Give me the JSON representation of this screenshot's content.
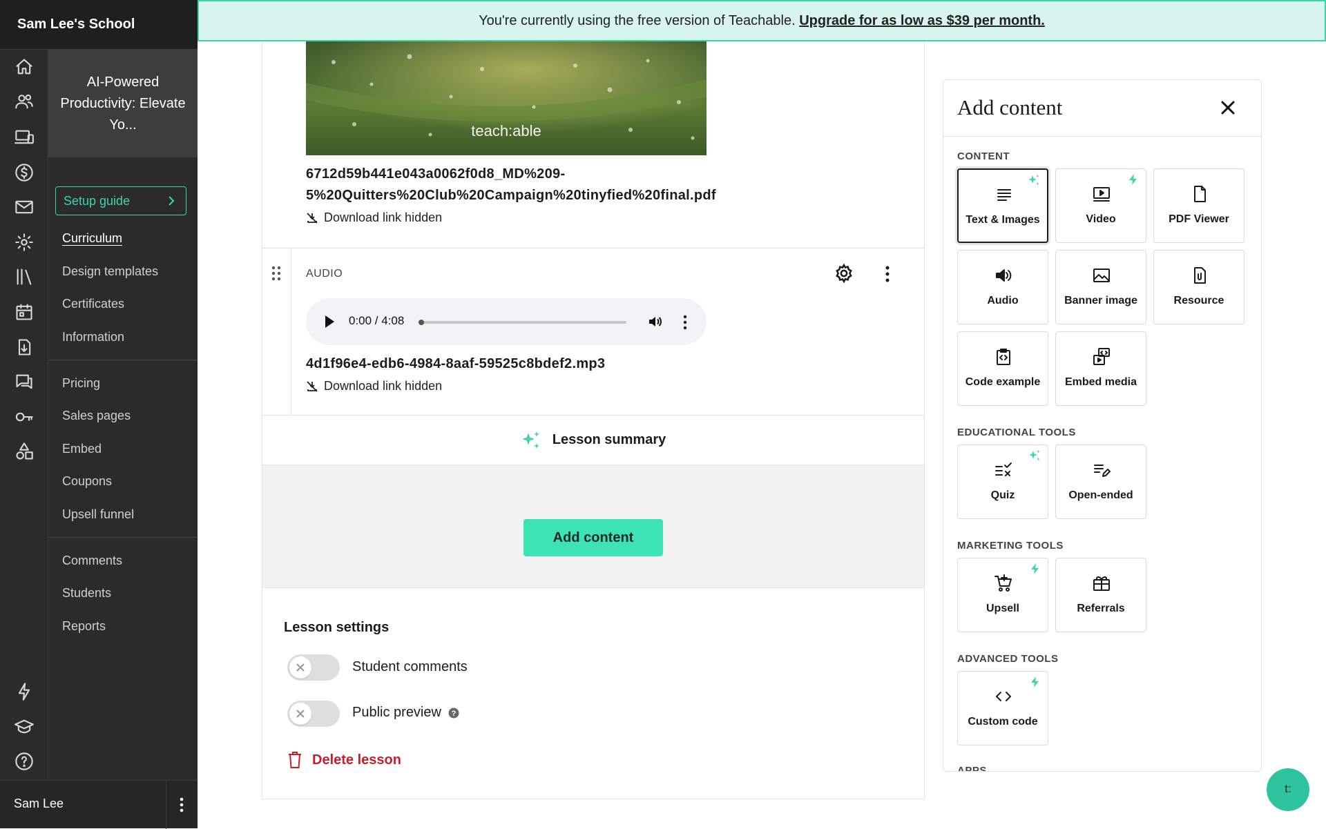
{
  "sidebar": {
    "school_name": "Sam Lee's School",
    "course_title": "AI-Powered Productivity: Elevate Yo...",
    "setup_guide": "Setup guide",
    "nav_group1": [
      "Curriculum",
      "Design templates",
      "Certificates",
      "Information"
    ],
    "nav_group2": [
      "Pricing",
      "Sales pages",
      "Embed",
      "Coupons",
      "Upsell funnel"
    ],
    "nav_group3": [
      "Comments",
      "Students",
      "Reports"
    ],
    "active_item": "Curriculum",
    "rail_icons": [
      "home-icon",
      "users-icon",
      "devices-icon",
      "dollar-icon",
      "mail-icon",
      "settings-icon",
      "library-icon",
      "calendar-icon",
      "download-icon",
      "chat-icon",
      "key-icon",
      "shapes-icon",
      "bolt-icon",
      "graduation-cap-icon",
      "help-icon"
    ],
    "user_name": "Sam Lee"
  },
  "banner": {
    "text": "You're currently using the free version of Teachable.",
    "link": "Upgrade for as low as $39 per month."
  },
  "lesson": {
    "pdf_watermark": "teach:able",
    "pdf_filename_line1": "6712d59b441e043a0062f0d8_MD%209-",
    "pdf_filename_line2": "5%20Quitters%20Club%20Campaign%20tinyfied%20final.pdf",
    "download_hidden": "Download link hidden",
    "audio_label": "AUDIO",
    "audio_time": "0:00 / 4:08",
    "audio_progress": 0,
    "audio_filename": "4d1f96e4-edb6-4984-8aaf-59525c8bdef2.mp3",
    "summary_label": "Lesson summary",
    "add_content_button": "Add content",
    "settings_title": "Lesson settings",
    "student_comments": "Student comments",
    "student_comments_on": false,
    "public_preview": "Public preview",
    "public_preview_on": false,
    "delete_lesson": "Delete lesson"
  },
  "panel": {
    "title": "Add content",
    "sections": {
      "content": "CONTENT",
      "educational": "EDUCATIONAL TOOLS",
      "marketing": "MARKETING TOOLS",
      "advanced": "ADVANCED TOOLS",
      "apps": "APPS"
    },
    "tiles": {
      "text_images": "Text & Images",
      "video": "Video",
      "pdf_viewer": "PDF Viewer",
      "audio": "Audio",
      "banner_image": "Banner image",
      "resource": "Resource",
      "code_example": "Code example",
      "embed_media": "Embed media",
      "quiz": "Quiz",
      "open_ended": "Open-ended",
      "upsell": "Upsell",
      "referrals": "Referrals",
      "custom_code": "Custom code"
    }
  },
  "chat_button": "t:",
  "colors": {
    "accent": "#3de3b5",
    "danger": "#c4202b",
    "sidebar_bg": "#2b2b2b",
    "banner_bg": "#d8f5ed"
  }
}
